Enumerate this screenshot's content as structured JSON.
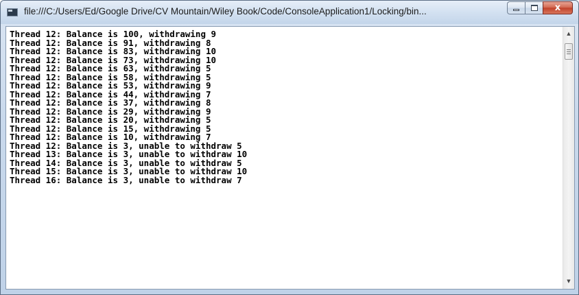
{
  "window": {
    "title": "file:///C:/Users/Ed/Google Drive/CV Mountain/Wiley Book/Code/ConsoleApplication1/Locking/bin...",
    "app_icon": "console-window-icon",
    "buttons": {
      "minimize_icon": "minimize-icon",
      "maximize_icon": "maximize-icon",
      "close_icon": "close-icon",
      "close_glyph": "x"
    }
  },
  "console": {
    "lines": [
      "Thread 12: Balance is 100, withdrawing 9",
      "Thread 12: Balance is 91, withdrawing 8",
      "Thread 12: Balance is 83, withdrawing 10",
      "Thread 12: Balance is 73, withdrawing 10",
      "Thread 12: Balance is 63, withdrawing 5",
      "Thread 12: Balance is 58, withdrawing 5",
      "Thread 12: Balance is 53, withdrawing 9",
      "Thread 12: Balance is 44, withdrawing 7",
      "Thread 12: Balance is 37, withdrawing 8",
      "Thread 12: Balance is 29, withdrawing 9",
      "Thread 12: Balance is 20, withdrawing 5",
      "Thread 12: Balance is 15, withdrawing 5",
      "Thread 12: Balance is 10, withdrawing 7",
      "Thread 12: Balance is 3, unable to withdraw 5",
      "Thread 13: Balance is 3, unable to withdraw 10",
      "Thread 14: Balance is 3, unable to withdraw 5",
      "Thread 15: Balance is 3, unable to withdraw 10",
      "Thread 16: Balance is 3, unable to withdraw 7"
    ]
  },
  "scrollbar": {
    "up_glyph": "▲",
    "down_glyph": "▼",
    "position": 0.0
  }
}
